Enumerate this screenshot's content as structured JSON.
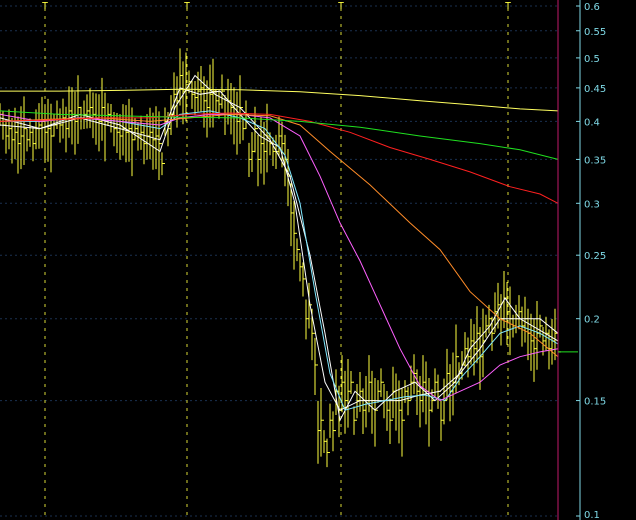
{
  "chart_data": {
    "type": "line",
    "scale": "log",
    "grid": true,
    "ylim": [
      0.1,
      0.6
    ],
    "y_ticks": [
      "0.6",
      "0.55",
      "0.5",
      "0.45",
      "0.4",
      "0.35",
      "0.3",
      "0.25",
      "0.2",
      "0.15",
      "0.1"
    ],
    "x_markers": [
      45,
      187,
      341,
      508
    ],
    "x_marker_glyph": "T",
    "colors": {
      "price": "#ffff40",
      "ma_white": "#ffffff",
      "ma_cyan": "#80e8ff",
      "ma_magenta": "#ff60ff",
      "ma_orange": "#ff8c28",
      "ma_red": "#ff2020",
      "ma_green": "#20e020",
      "ma_yellow": "#ffff60",
      "grid": "#1a3050",
      "axis": "#7fd9e6",
      "last_marker": "#c01a6a"
    },
    "price_bars": [
      [
        0,
        0.41
      ],
      [
        3,
        0.395
      ],
      [
        6,
        0.38
      ],
      [
        9,
        0.39
      ],
      [
        12,
        0.375
      ],
      [
        15,
        0.385
      ],
      [
        18,
        0.37
      ],
      [
        21,
        0.38
      ],
      [
        24,
        0.39
      ],
      [
        27,
        0.375
      ],
      [
        30,
        0.385
      ],
      [
        33,
        0.37
      ],
      [
        36,
        0.39
      ],
      [
        39,
        0.395
      ],
      [
        42,
        0.4
      ],
      [
        45,
        0.385
      ],
      [
        48,
        0.39
      ],
      [
        51,
        0.38
      ],
      [
        54,
        0.395
      ],
      [
        57,
        0.41
      ],
      [
        60,
        0.395
      ],
      [
        63,
        0.405
      ],
      [
        66,
        0.39
      ],
      [
        69,
        0.415
      ],
      [
        72,
        0.41
      ],
      [
        75,
        0.4
      ],
      [
        78,
        0.42
      ],
      [
        81,
        0.405
      ],
      [
        84,
        0.41
      ],
      [
        87,
        0.415
      ],
      [
        90,
        0.42
      ],
      [
        93,
        0.41
      ],
      [
        96,
        0.405
      ],
      [
        99,
        0.4
      ],
      [
        102,
        0.42
      ],
      [
        105,
        0.395
      ],
      [
        108,
        0.41
      ],
      [
        111,
        0.405
      ],
      [
        114,
        0.39
      ],
      [
        117,
        0.385
      ],
      [
        120,
        0.38
      ],
      [
        123,
        0.39
      ],
      [
        126,
        0.385
      ],
      [
        129,
        0.39
      ],
      [
        132,
        0.375
      ],
      [
        135,
        0.39
      ],
      [
        138,
        0.38
      ],
      [
        141,
        0.385
      ],
      [
        144,
        0.37
      ],
      [
        147,
        0.38
      ],
      [
        150,
        0.385
      ],
      [
        153,
        0.375
      ],
      [
        156,
        0.38
      ],
      [
        159,
        0.37
      ],
      [
        162,
        0.345
      ],
      [
        165,
        0.4
      ],
      [
        168,
        0.39
      ],
      [
        171,
        0.41
      ],
      [
        174,
        0.44
      ],
      [
        177,
        0.43
      ],
      [
        180,
        0.47
      ],
      [
        183,
        0.445
      ],
      [
        186,
        0.455
      ],
      [
        189,
        0.46
      ],
      [
        192,
        0.44
      ],
      [
        195,
        0.435
      ],
      [
        198,
        0.445
      ],
      [
        201,
        0.45
      ],
      [
        204,
        0.43
      ],
      [
        207,
        0.42
      ],
      [
        210,
        0.44
      ],
      [
        213,
        0.445
      ],
      [
        216,
        0.43
      ],
      [
        219,
        0.425
      ],
      [
        222,
        0.445
      ],
      [
        225,
        0.41
      ],
      [
        228,
        0.43
      ],
      [
        231,
        0.42
      ],
      [
        234,
        0.41
      ],
      [
        237,
        0.4
      ],
      [
        240,
        0.42
      ],
      [
        243,
        0.39
      ],
      [
        246,
        0.41
      ],
      [
        249,
        0.35
      ],
      [
        252,
        0.36
      ],
      [
        255,
        0.39
      ],
      [
        258,
        0.35
      ],
      [
        261,
        0.37
      ],
      [
        264,
        0.36
      ],
      [
        267,
        0.38
      ],
      [
        270,
        0.37
      ],
      [
        273,
        0.36
      ],
      [
        276,
        0.36
      ],
      [
        279,
        0.38
      ],
      [
        282,
        0.37
      ],
      [
        285,
        0.35
      ],
      [
        288,
        0.33
      ],
      [
        291,
        0.29
      ],
      [
        294,
        0.27
      ],
      [
        297,
        0.255
      ],
      [
        300,
        0.24
      ],
      [
        303,
        0.23
      ],
      [
        306,
        0.2
      ],
      [
        309,
        0.21
      ],
      [
        312,
        0.19
      ],
      [
        315,
        0.17
      ],
      [
        318,
        0.135
      ],
      [
        321,
        0.14
      ],
      [
        324,
        0.13
      ],
      [
        327,
        0.125
      ],
      [
        330,
        0.14
      ],
      [
        333,
        0.135
      ],
      [
        336,
        0.155
      ],
      [
        339,
        0.145
      ],
      [
        342,
        0.16
      ],
      [
        345,
        0.15
      ],
      [
        348,
        0.155
      ],
      [
        351,
        0.16
      ],
      [
        354,
        0.14
      ],
      [
        357,
        0.15
      ],
      [
        360,
        0.155
      ],
      [
        363,
        0.145
      ],
      [
        366,
        0.15
      ],
      [
        369,
        0.16
      ],
      [
        372,
        0.15
      ],
      [
        375,
        0.145
      ],
      [
        378,
        0.155
      ],
      [
        381,
        0.16
      ],
      [
        384,
        0.15
      ],
      [
        387,
        0.145
      ],
      [
        390,
        0.14
      ],
      [
        393,
        0.155
      ],
      [
        396,
        0.15
      ],
      [
        399,
        0.145
      ],
      [
        402,
        0.14
      ],
      [
        405,
        0.155
      ],
      [
        408,
        0.15
      ],
      [
        411,
        0.16
      ],
      [
        414,
        0.165
      ],
      [
        417,
        0.155
      ],
      [
        420,
        0.15
      ],
      [
        423,
        0.16
      ],
      [
        426,
        0.155
      ],
      [
        429,
        0.145
      ],
      [
        432,
        0.15
      ],
      [
        435,
        0.16
      ],
      [
        438,
        0.155
      ],
      [
        441,
        0.14
      ],
      [
        444,
        0.15
      ],
      [
        447,
        0.165
      ],
      [
        450,
        0.155
      ],
      [
        453,
        0.16
      ],
      [
        456,
        0.175
      ],
      [
        459,
        0.165
      ],
      [
        462,
        0.17
      ],
      [
        465,
        0.18
      ],
      [
        468,
        0.175
      ],
      [
        471,
        0.185
      ],
      [
        474,
        0.18
      ],
      [
        477,
        0.19
      ],
      [
        480,
        0.175
      ],
      [
        483,
        0.185
      ],
      [
        486,
        0.195
      ],
      [
        489,
        0.2
      ],
      [
        492,
        0.19
      ],
      [
        495,
        0.205
      ],
      [
        498,
        0.21
      ],
      [
        501,
        0.2
      ],
      [
        504,
        0.215
      ],
      [
        507,
        0.205
      ],
      [
        510,
        0.2
      ],
      [
        513,
        0.195
      ],
      [
        516,
        0.2
      ],
      [
        519,
        0.205
      ],
      [
        522,
        0.195
      ],
      [
        525,
        0.2
      ],
      [
        528,
        0.19
      ],
      [
        531,
        0.185
      ],
      [
        534,
        0.18
      ],
      [
        537,
        0.19
      ],
      [
        540,
        0.195
      ],
      [
        543,
        0.185
      ],
      [
        546,
        0.19
      ],
      [
        549,
        0.18
      ],
      [
        552,
        0.185
      ],
      [
        555,
        0.19
      ],
      [
        558,
        0.178
      ]
    ],
    "series": [
      {
        "color_key": "ma_white",
        "points": [
          [
            0,
            0.405
          ],
          [
            40,
            0.39
          ],
          [
            80,
            0.405
          ],
          [
            120,
            0.39
          ],
          [
            160,
            0.375
          ],
          [
            180,
            0.45
          ],
          [
            200,
            0.44
          ],
          [
            220,
            0.445
          ],
          [
            240,
            0.41
          ],
          [
            260,
            0.38
          ],
          [
            280,
            0.365
          ],
          [
            295,
            0.3
          ],
          [
            310,
            0.21
          ],
          [
            325,
            0.16
          ],
          [
            340,
            0.145
          ],
          [
            360,
            0.15
          ],
          [
            380,
            0.15
          ],
          [
            400,
            0.15
          ],
          [
            420,
            0.153
          ],
          [
            440,
            0.155
          ],
          [
            460,
            0.165
          ],
          [
            480,
            0.18
          ],
          [
            500,
            0.2
          ],
          [
            520,
            0.2
          ],
          [
            540,
            0.192
          ],
          [
            558,
            0.185
          ]
        ]
      },
      {
        "color_key": "ma_white",
        "points": [
          [
            0,
            0.395
          ],
          [
            40,
            0.39
          ],
          [
            80,
            0.41
          ],
          [
            120,
            0.395
          ],
          [
            160,
            0.36
          ],
          [
            175,
            0.42
          ],
          [
            195,
            0.47
          ],
          [
            215,
            0.44
          ],
          [
            240,
            0.42
          ],
          [
            270,
            0.375
          ],
          [
            290,
            0.33
          ],
          [
            310,
            0.25
          ],
          [
            325,
            0.19
          ],
          [
            340,
            0.14
          ],
          [
            355,
            0.155
          ],
          [
            375,
            0.145
          ],
          [
            395,
            0.155
          ],
          [
            415,
            0.16
          ],
          [
            435,
            0.15
          ],
          [
            455,
            0.16
          ],
          [
            470,
            0.18
          ],
          [
            490,
            0.195
          ],
          [
            505,
            0.215
          ],
          [
            520,
            0.2
          ],
          [
            540,
            0.2
          ],
          [
            558,
            0.19
          ]
        ]
      },
      {
        "color_key": "ma_cyan",
        "points": [
          [
            0,
            0.4
          ],
          [
            40,
            0.4
          ],
          [
            80,
            0.405
          ],
          [
            120,
            0.4
          ],
          [
            160,
            0.39
          ],
          [
            180,
            0.41
          ],
          [
            210,
            0.415
          ],
          [
            240,
            0.405
          ],
          [
            265,
            0.39
          ],
          [
            285,
            0.355
          ],
          [
            300,
            0.3
          ],
          [
            315,
            0.22
          ],
          [
            330,
            0.165
          ],
          [
            345,
            0.145
          ],
          [
            365,
            0.148
          ],
          [
            385,
            0.15
          ],
          [
            405,
            0.152
          ],
          [
            425,
            0.153
          ],
          [
            445,
            0.15
          ],
          [
            460,
            0.162
          ],
          [
            480,
            0.175
          ],
          [
            500,
            0.19
          ],
          [
            520,
            0.195
          ],
          [
            540,
            0.19
          ],
          [
            558,
            0.183
          ]
        ]
      },
      {
        "color_key": "ma_magenta",
        "points": [
          [
            0,
            0.41
          ],
          [
            40,
            0.4
          ],
          [
            80,
            0.405
          ],
          [
            120,
            0.4
          ],
          [
            160,
            0.395
          ],
          [
            180,
            0.405
          ],
          [
            210,
            0.41
          ],
          [
            240,
            0.41
          ],
          [
            270,
            0.405
          ],
          [
            300,
            0.38
          ],
          [
            320,
            0.33
          ],
          [
            340,
            0.28
          ],
          [
            360,
            0.245
          ],
          [
            380,
            0.21
          ],
          [
            400,
            0.18
          ],
          [
            420,
            0.158
          ],
          [
            440,
            0.15
          ],
          [
            460,
            0.155
          ],
          [
            480,
            0.16
          ],
          [
            500,
            0.17
          ],
          [
            520,
            0.175
          ],
          [
            540,
            0.178
          ],
          [
            558,
            0.18
          ]
        ]
      },
      {
        "color_key": "ma_orange",
        "points": [
          [
            0,
            0.4
          ],
          [
            50,
            0.403
          ],
          [
            100,
            0.405
          ],
          [
            150,
            0.4
          ],
          [
            190,
            0.405
          ],
          [
            230,
            0.41
          ],
          [
            270,
            0.408
          ],
          [
            300,
            0.395
          ],
          [
            330,
            0.36
          ],
          [
            370,
            0.32
          ],
          [
            410,
            0.28
          ],
          [
            440,
            0.255
          ],
          [
            470,
            0.22
          ],
          [
            500,
            0.2
          ],
          [
            530,
            0.19
          ],
          [
            558,
            0.175
          ]
        ]
      },
      {
        "color_key": "ma_red",
        "points": [
          [
            0,
            0.4
          ],
          [
            50,
            0.402
          ],
          [
            100,
            0.405
          ],
          [
            150,
            0.405
          ],
          [
            190,
            0.41
          ],
          [
            230,
            0.412
          ],
          [
            270,
            0.41
          ],
          [
            310,
            0.4
          ],
          [
            350,
            0.385
          ],
          [
            390,
            0.365
          ],
          [
            430,
            0.35
          ],
          [
            470,
            0.335
          ],
          [
            510,
            0.318
          ],
          [
            540,
            0.31
          ],
          [
            558,
            0.3
          ]
        ]
      },
      {
        "color_key": "ma_green",
        "points": [
          [
            0,
            0.415
          ],
          [
            60,
            0.41
          ],
          [
            120,
            0.408
          ],
          [
            180,
            0.406
          ],
          [
            240,
            0.405
          ],
          [
            300,
            0.4
          ],
          [
            360,
            0.392
          ],
          [
            420,
            0.38
          ],
          [
            480,
            0.37
          ],
          [
            520,
            0.362
          ],
          [
            558,
            0.35
          ]
        ]
      },
      {
        "color_key": "ma_yellow",
        "points": [
          [
            0,
            0.445
          ],
          [
            60,
            0.445
          ],
          [
            120,
            0.446
          ],
          [
            180,
            0.448
          ],
          [
            240,
            0.447
          ],
          [
            300,
            0.444
          ],
          [
            360,
            0.438
          ],
          [
            420,
            0.43
          ],
          [
            480,
            0.423
          ],
          [
            520,
            0.418
          ],
          [
            558,
            0.415
          ]
        ]
      }
    ],
    "last_value": 0.178
  }
}
